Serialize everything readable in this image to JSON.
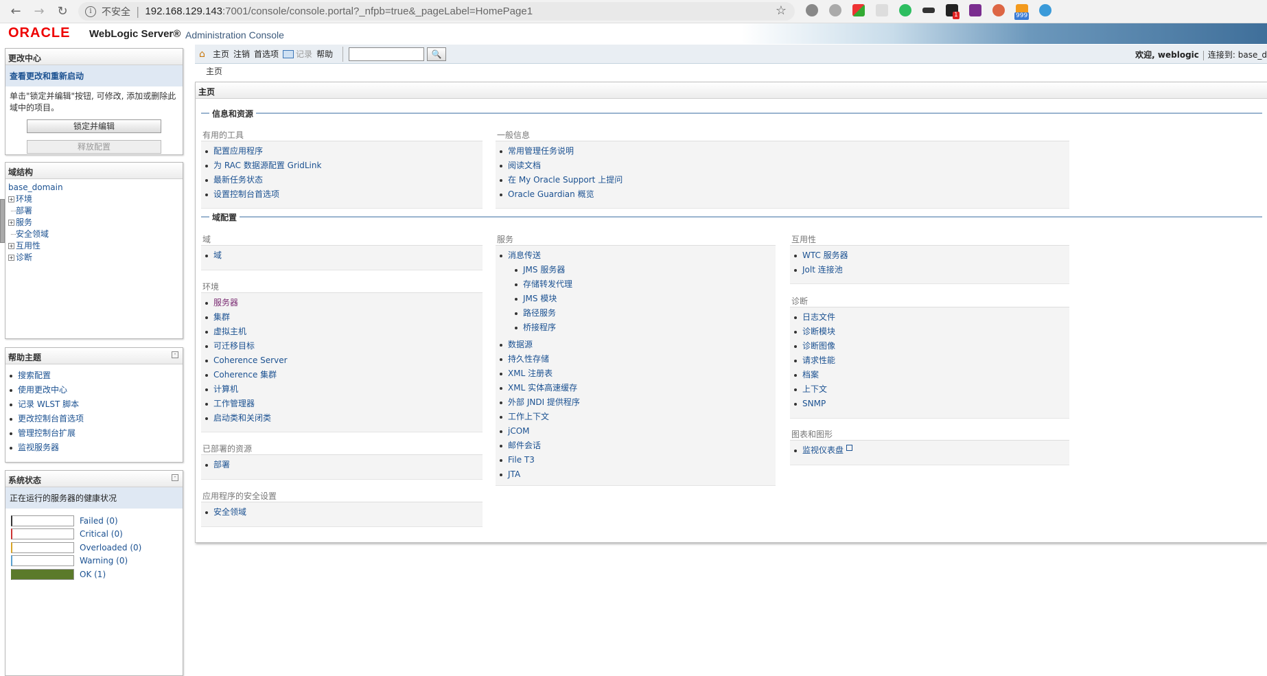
{
  "browser": {
    "security_label": "不安全",
    "url_host": "192.168.129.143",
    "url_rest": ":7001/console/console.portal?_nfpb=true&_pageLabel=HomePage1",
    "badges": [
      "1",
      "999"
    ]
  },
  "banner": {
    "logo": "ORACLE",
    "product": "WebLogic Server®",
    "subtitle": "Administration Console"
  },
  "toolbar": {
    "home": "主页",
    "logout": "注销",
    "preferences": "首选项",
    "record": "记录",
    "help": "帮助",
    "search_value": "",
    "welcome": "欢迎, weblogic",
    "connected": "连接到: base_d"
  },
  "breadcrumb": "主页",
  "change_center": {
    "title": "更改中心",
    "subhead": "查看更改和重新启动",
    "text": "单击\"锁定并编辑\"按钮, 可修改, 添加或删除此域中的项目。",
    "lock_button": "锁定并编辑",
    "release_button": "释放配置"
  },
  "domain_structure": {
    "title": "域结构",
    "root": "base_domain",
    "nodes": [
      {
        "label": "环境",
        "expandable": true
      },
      {
        "label": "部署",
        "expandable": false
      },
      {
        "label": "服务",
        "expandable": true
      },
      {
        "label": "安全领域",
        "expandable": false
      },
      {
        "label": "互用性",
        "expandable": true
      },
      {
        "label": "诊断",
        "expandable": true
      }
    ]
  },
  "help_topics": {
    "title": "帮助主题",
    "items": [
      "搜索配置",
      "使用更改中心",
      "记录 WLST 脚本",
      "更改控制台首选项",
      "管理控制台扩展",
      "监视服务器"
    ]
  },
  "system_status": {
    "title": "系统状态",
    "subhead": "正在运行的服务器的健康状况",
    "rows": [
      {
        "label": "Failed (0)",
        "color": "#333333",
        "fill": 0
      },
      {
        "label": "Critical (0)",
        "color": "#cc3333",
        "fill": 0
      },
      {
        "label": "Overloaded (0)",
        "color": "#d9a426",
        "fill": 0
      },
      {
        "label": "Warning (0)",
        "color": "#5aa0d0",
        "fill": 0
      },
      {
        "label": "OK (1)",
        "color": "#5b7a2a",
        "fill": 1
      }
    ]
  },
  "main": {
    "title": "主页",
    "section1": "信息和资源",
    "section2": "域配置",
    "useful_tools": {
      "heading": "有用的工具",
      "items": [
        "配置应用程序",
        "为 RAC 数据源配置 GridLink",
        "最新任务状态",
        "设置控制台首选项"
      ]
    },
    "general_info": {
      "heading": "一般信息",
      "items": [
        "常用管理任务说明",
        "阅读文档",
        "在 My Oracle Support 上提问",
        "Oracle Guardian 概览"
      ]
    },
    "domain": {
      "heading": "域",
      "items": [
        "域"
      ]
    },
    "environment": {
      "heading": "环境",
      "items": [
        "服务器",
        "集群",
        "虚拟主机",
        "可迁移目标",
        "Coherence Server",
        "Coherence 集群",
        "计算机",
        "工作管理器",
        "启动类和关闭类"
      ]
    },
    "deployed": {
      "heading": "已部署的资源",
      "items": [
        "部署"
      ]
    },
    "app_security": {
      "heading": "应用程序的安全设置",
      "items": [
        "安全领域"
      ]
    },
    "services": {
      "heading": "服务",
      "messaging": "消息传送",
      "messaging_sub": [
        "JMS 服务器",
        "存储转发代理",
        "JMS 模块",
        "路径服务",
        "桥接程序"
      ],
      "items": [
        "数据源",
        "持久性存储",
        "XML 注册表",
        "XML 实体高速缓存",
        "外部 JNDI 提供程序",
        "工作上下文",
        "jCOM",
        "邮件会话",
        "File T3",
        "JTA"
      ]
    },
    "interop": {
      "heading": "互用性",
      "items": [
        "WTC 服务器",
        "Jolt 连接池"
      ]
    },
    "diagnostics": {
      "heading": "诊断",
      "items": [
        "日志文件",
        "诊断模块",
        "诊断图像",
        "请求性能",
        "档案",
        "上下文",
        "SNMP"
      ]
    },
    "charts": {
      "heading": "图表和图形",
      "items": [
        "监视仪表盘"
      ]
    }
  }
}
